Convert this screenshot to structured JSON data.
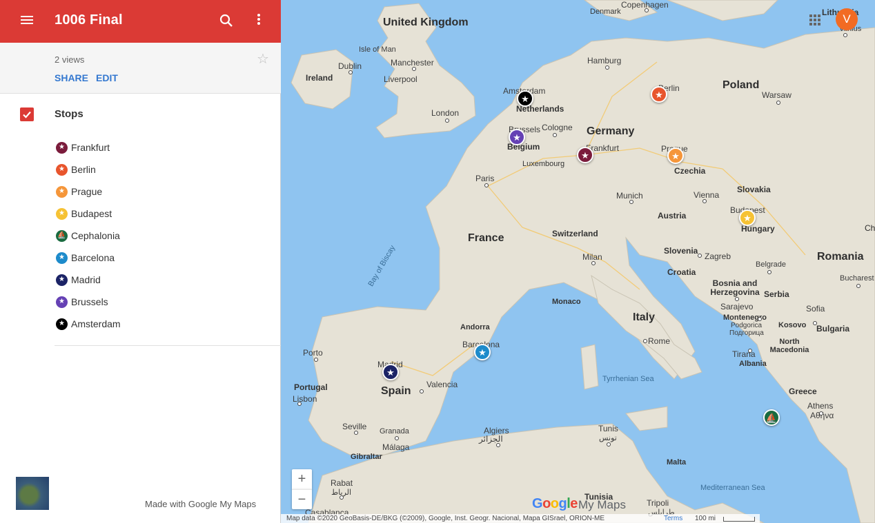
{
  "header": {
    "title": "1006 Final"
  },
  "info": {
    "views": "2 views",
    "share_label": "SHARE",
    "edit_label": "EDIT"
  },
  "layer": {
    "title": "Stops",
    "checked": true,
    "stops": [
      {
        "label": "Frankfurt",
        "color": "#7b1c3c",
        "icon": "star-icon"
      },
      {
        "label": "Berlin",
        "color": "#e8552d",
        "icon": "star-icon"
      },
      {
        "label": "Prague",
        "color": "#f5963a",
        "icon": "star-icon"
      },
      {
        "label": "Budapest",
        "color": "#f6c234",
        "icon": "star-icon"
      },
      {
        "label": "Cephalonia",
        "color": "#1a6b40",
        "icon": "sailboat-icon"
      },
      {
        "label": "Barcelona",
        "color": "#1d8bcb",
        "icon": "star-icon"
      },
      {
        "label": "Madrid",
        "color": "#1b2366",
        "icon": "star-icon"
      },
      {
        "label": "Brussels",
        "color": "#6541b4",
        "icon": "star-icon"
      },
      {
        "label": "Amsterdam",
        "color": "#000000",
        "icon": "star-icon"
      }
    ]
  },
  "footer": {
    "made_with": "Made with Google My Maps"
  },
  "map": {
    "avatar_initial": "V",
    "zoom_in": "+",
    "zoom_out": "−",
    "logo_google": [
      "G",
      "o",
      "o",
      "g",
      "l",
      "e"
    ],
    "logo_mymaps": "My Maps",
    "attribution": "Map data ©2020 GeoBasis-DE/BKG (©2009), Google, Inst. Geogr. Nacional, Mapa GISrael, ORION-ME",
    "terms": "Terms",
    "scale": "100 mi",
    "country_labels": [
      "United Kingdom",
      "Ireland",
      "Netherlands",
      "Belgium",
      "Luxembourg",
      "Germany",
      "Poland",
      "Czechia",
      "Slovakia",
      "Austria",
      "Hungary",
      "Switzerland",
      "France",
      "Slovenia",
      "Croatia",
      "Bosnia and Herzegovina",
      "Serbia",
      "Romania",
      "Montenegro",
      "Kosovo",
      "North Macedonia",
      "Albania",
      "Bulgaria",
      "Greece",
      "Italy",
      "Andorra",
      "Monaco",
      "Portugal",
      "Spain",
      "Lithuania",
      "Denmark",
      "Malta"
    ],
    "city_labels": [
      "Copenhagen",
      "Isle of Man",
      "Dublin",
      "Manchester",
      "Liverpool",
      "London",
      "Amsterdam",
      "Hamburg",
      "Berlin",
      "Warsaw",
      "Brussels",
      "Cologne",
      "Frankfurt",
      "Prague",
      "Paris",
      "Munich",
      "Vienna",
      "Budapest",
      "Milan",
      "Zagreb",
      "Belgrade",
      "Sarajevo",
      "Bucharest",
      "Sofia",
      "Podgorica",
      "Подгорица",
      "Tirana",
      "Athens",
      "Αθήνα",
      "Rome",
      "Barcelona",
      "Madrid",
      "Valencia",
      "Porto",
      "Lisbon",
      "Seville",
      "Granada",
      "Málaga",
      "Gibraltar",
      "Algiers",
      "الجزائر",
      "Tunis",
      "تونس",
      "Tunisia",
      "Tripoli",
      "طرابلس",
      "Rabat",
      "الرباط",
      "Casablanca",
      "Vilnius"
    ],
    "sea_labels": [
      "Bay of Biscay",
      "Tyrrhenian Sea",
      "Mediterranean Sea"
    ],
    "partial_labels": [
      "Ch"
    ]
  }
}
